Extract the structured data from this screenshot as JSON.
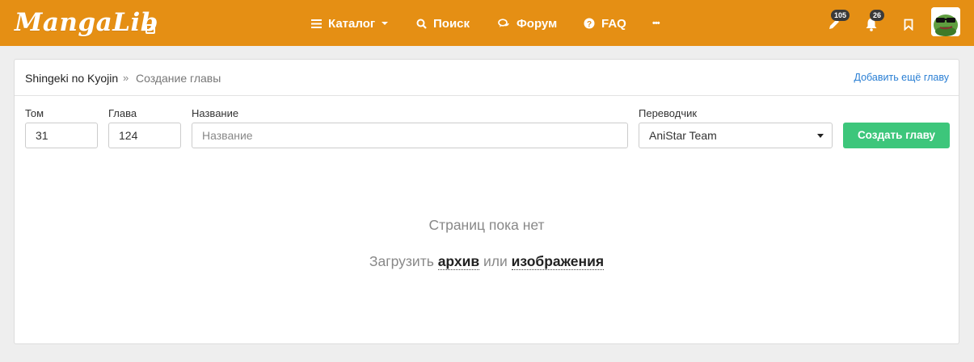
{
  "header": {
    "logo": "MangaLib",
    "nav": {
      "catalog": "Каталог",
      "search": "Поиск",
      "forum": "Форум",
      "faq": "FAQ",
      "more": "•••"
    },
    "badges": {
      "edits": "105",
      "notifications": "26"
    },
    "accent": "#e58f14"
  },
  "breadcrumb": {
    "manga": "Shingeki no Kyojin",
    "separator": "»",
    "current": "Создание главы"
  },
  "add_more_link": "Добавить ещё главу",
  "form": {
    "volume": {
      "label": "Том",
      "value": "31"
    },
    "chapter": {
      "label": "Глава",
      "value": "124"
    },
    "title": {
      "label": "Название",
      "placeholder": "Название"
    },
    "translator": {
      "label": "Переводчик",
      "value": "AniStar Team"
    },
    "submit_label": "Создать главу",
    "submit_color": "#3dc67b"
  },
  "empty_state": {
    "title": "Страниц пока нет",
    "upload_prefix": "Загрузить",
    "archive_link": "архив",
    "or": "или",
    "images_link": "изображения"
  }
}
